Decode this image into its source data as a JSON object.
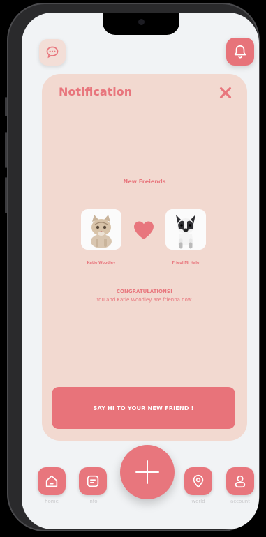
{
  "header": {
    "chat_icon": "chat-bubble-icon",
    "bell_icon": "bell-icon"
  },
  "card": {
    "title": "Notification",
    "subtitle": "New Freiends",
    "pet1_name": "Katie Woodley",
    "pet2_name": "Frieul Mi Hale",
    "congrats": "CONGRATULATIONS!",
    "message": "You and Katie Woodley are frienna now.",
    "cta": "SAY HI TO YOUR NEW FRIEND !"
  },
  "nav": {
    "home": "home",
    "info": "info",
    "world": "world",
    "account": "account"
  },
  "colors": {
    "accent": "#e8767d",
    "card_bg": "#f2d9d0",
    "screen_bg": "#f1f3f5"
  }
}
